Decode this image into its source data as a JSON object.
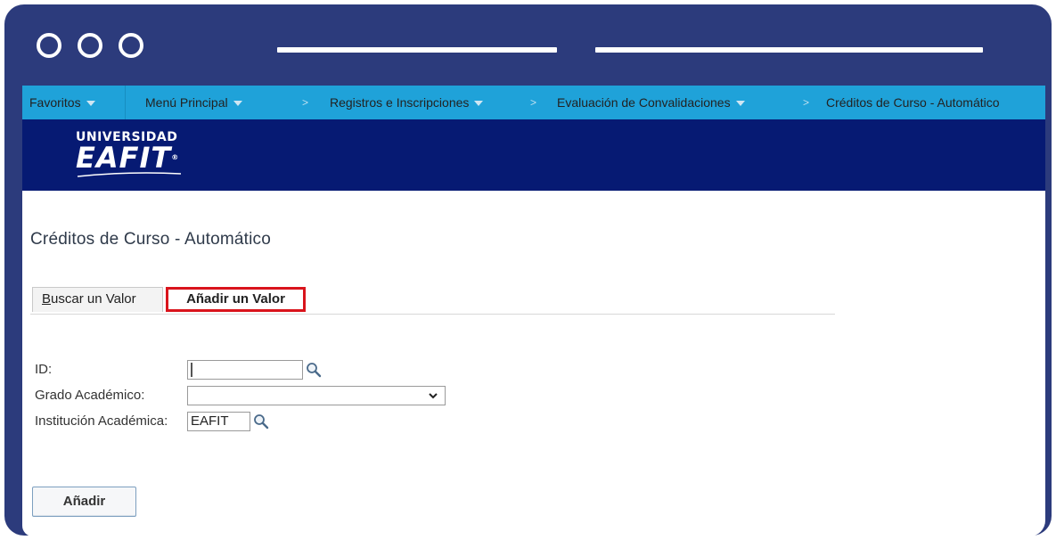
{
  "nav": {
    "favoritos": "Favoritos",
    "menu_principal": "Menú Principal",
    "registros": "Registros e Inscripciones",
    "evaluacion": "Evaluación de Convalidaciones",
    "current": "Créditos de Curso - Automático",
    "separator": ">"
  },
  "brand": {
    "line1": "UNIVERSIDAD",
    "line2": "EAFIT",
    "registered": "®",
    "banner_color": "#061a73",
    "nav_color": "#1fa2d9",
    "frame_color": "#2c3b7c"
  },
  "page": {
    "title": "Créditos de Curso - Automático"
  },
  "tabs": {
    "search_first": "B",
    "search_rest": "uscar un Valor",
    "add": "Añadir un Valor",
    "highlight_color": "#d9141c"
  },
  "form": {
    "id_label": "ID:",
    "id_value": "",
    "grado_label": "Grado Académico:",
    "grado_value": "",
    "institucion_label": "Institución Académica:",
    "institucion_value": "EAFIT"
  },
  "actions": {
    "add_button": "Añadir"
  },
  "icons": {
    "lookup": "magnifier-icon",
    "dropdown": "chevron-down-icon",
    "nav_caret": "caret-down-icon",
    "window_controls": "circle-icon"
  }
}
